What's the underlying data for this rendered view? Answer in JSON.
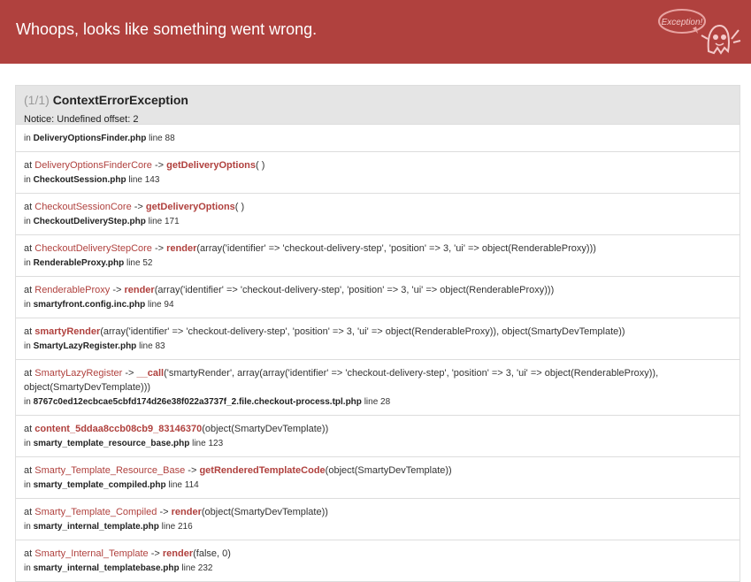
{
  "header": {
    "title": "Whoops, looks like something went wrong.",
    "logo_text": "Exception!"
  },
  "exception": {
    "count": "(1/1)",
    "name": "ContextErrorException",
    "message": "Notice: Undefined offset: 2"
  },
  "frames": [
    {
      "prefix": "",
      "cls": "",
      "sep": "",
      "fn": "",
      "args": "",
      "file": "DeliveryOptionsFinder.php",
      "line": "88"
    },
    {
      "prefix": "at",
      "cls": "DeliveryOptionsFinderCore",
      "sep": "->",
      "fn": "getDeliveryOptions",
      "args": "( )",
      "file": "CheckoutSession.php",
      "line": "143"
    },
    {
      "prefix": "at",
      "cls": "CheckoutSessionCore",
      "sep": "->",
      "fn": "getDeliveryOptions",
      "args": "( )",
      "file": "CheckoutDeliveryStep.php",
      "line": "171"
    },
    {
      "prefix": "at",
      "cls": "CheckoutDeliveryStepCore",
      "sep": "->",
      "fn": "render",
      "args": "(array('identifier' => 'checkout-delivery-step', 'position' => 3, 'ui' => object(RenderableProxy)))",
      "file": "RenderableProxy.php",
      "line": "52"
    },
    {
      "prefix": "at",
      "cls": "RenderableProxy",
      "sep": "->",
      "fn": "render",
      "args": "(array('identifier' => 'checkout-delivery-step', 'position' => 3, 'ui' => object(RenderableProxy)))",
      "file": "smartyfront.config.inc.php",
      "line": "94"
    },
    {
      "prefix": "at",
      "cls": "",
      "sep": "",
      "fn": "smartyRender",
      "args": "(array('identifier' => 'checkout-delivery-step', 'position' => 3, 'ui' => object(RenderableProxy)), object(SmartyDevTemplate))",
      "file": "SmartyLazyRegister.php",
      "line": "83"
    },
    {
      "prefix": "at",
      "cls": "SmartyLazyRegister",
      "sep": "->",
      "fn": "__call",
      "args": "('smartyRender', array(array('identifier' => 'checkout-delivery-step', 'position' => 3, 'ui' => object(RenderableProxy)), object(SmartyDevTemplate)))",
      "file": "8767c0ed12ecbcae5cbfd174d26e38f022a3737f_2.file.checkout-process.tpl.php",
      "line": "28"
    },
    {
      "prefix": "at",
      "cls": "",
      "sep": "",
      "fn": "content_5ddaa8ccb08cb9_83146370",
      "args": "(object(SmartyDevTemplate))",
      "file": "smarty_template_resource_base.php",
      "line": "123"
    },
    {
      "prefix": "at",
      "cls": "Smarty_Template_Resource_Base",
      "sep": "->",
      "fn": "getRenderedTemplateCode",
      "args": "(object(SmartyDevTemplate))",
      "file": "smarty_template_compiled.php",
      "line": "114"
    },
    {
      "prefix": "at",
      "cls": "Smarty_Template_Compiled",
      "sep": "->",
      "fn": "render",
      "args": "(object(SmartyDevTemplate))",
      "file": "smarty_internal_template.php",
      "line": "216"
    },
    {
      "prefix": "at",
      "cls": "Smarty_Internal_Template",
      "sep": "->",
      "fn": "render",
      "args": "(false, 0)",
      "file": "smarty_internal_templatebase.php",
      "line": "232"
    }
  ],
  "labels": {
    "in": "in",
    "line": "line"
  },
  "colors": {
    "header": "#b0413e",
    "accent": "#b0413e"
  }
}
